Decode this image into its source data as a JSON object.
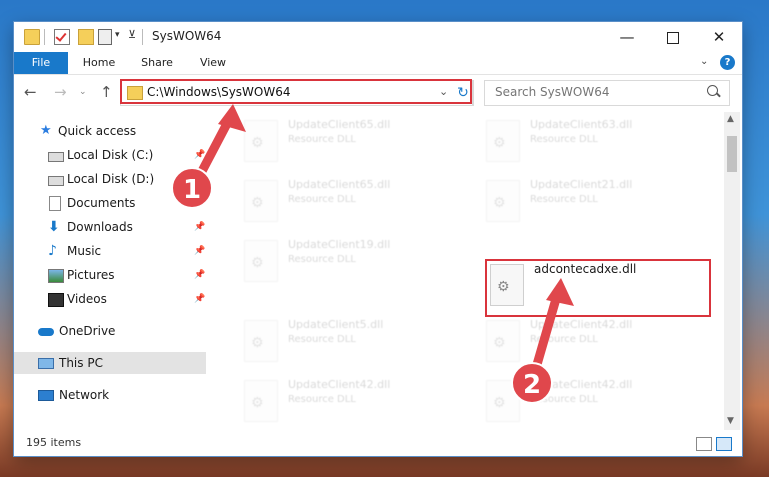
{
  "window": {
    "title": "SysWOW64",
    "minimize_glyph": "—",
    "close_glyph": "✕"
  },
  "ribbon": {
    "tabs": [
      "File",
      "Home",
      "Share",
      "View"
    ],
    "help_glyph": "?",
    "expand_glyph": "⌄"
  },
  "nav": {
    "back_glyph": "←",
    "forward_glyph": "→",
    "history_glyph": "⌄",
    "up_glyph": "↑",
    "address": "C:\\Windows\\SysWOW64",
    "address_dropdown_glyph": "⌄",
    "refresh_glyph": "↻",
    "search_placeholder": "Search SysWOW64"
  },
  "sidebar": {
    "items": [
      {
        "label": "Quick access",
        "icon": "star-icon"
      },
      {
        "label": "Local Disk (C:)",
        "icon": "drive-icon",
        "pinned": true
      },
      {
        "label": "Local Disk (D:)",
        "icon": "drive-icon"
      },
      {
        "label": "Documents",
        "icon": "documents-icon",
        "pinned": true
      },
      {
        "label": "Downloads",
        "icon": "downloads-icon",
        "pinned": true
      },
      {
        "label": "Music",
        "icon": "music-icon",
        "pinned": true
      },
      {
        "label": "Pictures",
        "icon": "pictures-icon",
        "pinned": true
      },
      {
        "label": "Videos",
        "icon": "videos-icon",
        "pinned": true
      },
      {
        "label": "OneDrive",
        "icon": "cloud-icon"
      },
      {
        "label": "This PC",
        "icon": "computer-icon",
        "selected": true
      },
      {
        "label": "Network",
        "icon": "network-icon"
      }
    ],
    "pin_glyph": "📌"
  },
  "files": [
    {
      "name": "UpdateClient65.dll",
      "type": "Resource DLL"
    },
    {
      "name": "UpdateClient63.dll",
      "type": "Resource DLL"
    },
    {
      "name": "UpdateClient65.dll",
      "type": "Resource DLL"
    },
    {
      "name": "UpdateClient21.dll",
      "type": "Resource DLL"
    },
    {
      "name": "UpdateClient19.dll",
      "type": "Resource DLL"
    },
    {
      "name": "adcontecadxe.dll",
      "type": ""
    },
    {
      "name": "UpdateClient5.dll",
      "type": "Resource DLL"
    },
    {
      "name": "UpdateClient42.dll",
      "type": "Resource DLL"
    },
    {
      "name": "UpdateClient42.dll",
      "type": "Resource DLL"
    },
    {
      "name": "UpdateClient42.dll",
      "type": "Resource DLL"
    }
  ],
  "status": {
    "item_count": "195 items"
  },
  "annotations": {
    "step1": "1",
    "step2": "2",
    "color": "#e0474c"
  }
}
